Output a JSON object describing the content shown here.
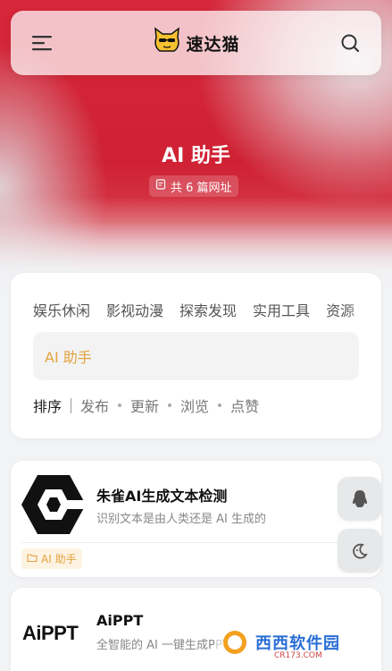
{
  "header": {
    "logo_text": "速达猫",
    "menu_icon": "menu-icon",
    "search_icon": "search-icon"
  },
  "hero": {
    "title": "AI 助手",
    "count_text": "共 6 篇网址"
  },
  "categories": [
    "娱乐休闲",
    "影视动漫",
    "探索发现",
    "实用工具",
    "资源"
  ],
  "active_category": "AI 助手",
  "sort": {
    "label": "排序",
    "options": [
      "发布",
      "更新",
      "浏览",
      "点赞"
    ]
  },
  "items": [
    {
      "title": "朱雀AI生成文本检测",
      "desc": "识别文本是由人类还是 AI 生成的",
      "tag": "AI 助手"
    },
    {
      "title": "AiPPT",
      "desc": "全智能的 AI 一键生成PPT",
      "logo_text": "AiPPT"
    }
  ],
  "floating": [
    "qq-icon",
    "moon-icon"
  ],
  "watermark": {
    "text": "西西软件园",
    "sub": "CR173.COM"
  },
  "colors": {
    "accent": "#e2a23c",
    "hero_red": "#d6283a"
  }
}
